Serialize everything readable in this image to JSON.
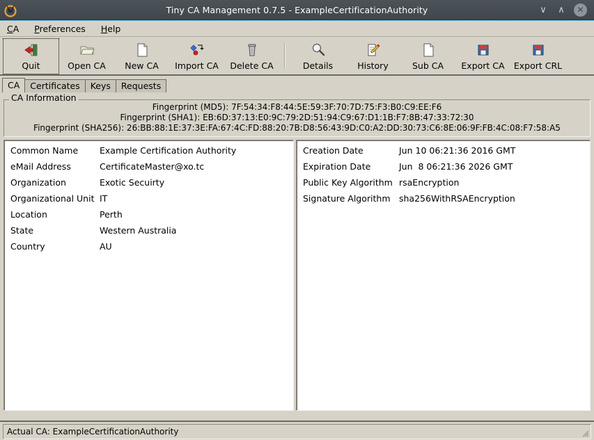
{
  "window": {
    "title": "Tiny CA Management 0.7.5 - ExampleCertificationAuthority",
    "app_icon": "tinyca-logo-icon",
    "minimize_label": "∨",
    "maximize_label": "∧",
    "close_label": "✕"
  },
  "menubar": {
    "items": [
      {
        "label": "CA",
        "mnemonic": "C",
        "rest": "A"
      },
      {
        "label": "Preferences",
        "mnemonic": "P",
        "rest": "references"
      },
      {
        "label": "Help",
        "mnemonic": "H",
        "rest": "elp"
      }
    ]
  },
  "toolbar": {
    "buttons": [
      {
        "label": "Quit",
        "icon": "exit-door-icon",
        "focused": true
      },
      {
        "label": "Open CA",
        "icon": "open-folder-icon",
        "focused": false
      },
      {
        "label": "New CA",
        "icon": "blank-page-icon",
        "focused": false
      },
      {
        "label": "Import CA",
        "icon": "import-arrow-icon",
        "focused": false
      },
      {
        "label": "Delete CA",
        "icon": "trash-can-icon",
        "focused": false
      },
      {
        "label": "Details",
        "icon": "magnifier-icon",
        "focused": false
      },
      {
        "label": "History",
        "icon": "page-pencil-icon",
        "focused": false
      },
      {
        "label": "Sub CA",
        "icon": "blank-page-icon",
        "focused": false
      },
      {
        "label": "Export CA",
        "icon": "floppy-disk-icon",
        "focused": false
      },
      {
        "label": "Export CRL",
        "icon": "floppy-disk-icon",
        "focused": false
      }
    ],
    "separator_after_index": 4
  },
  "tabs": [
    {
      "label": "CA",
      "active": true
    },
    {
      "label": "Certificates",
      "active": false
    },
    {
      "label": "Keys",
      "active": false
    },
    {
      "label": "Requests",
      "active": false
    }
  ],
  "ca_information": {
    "legend": "CA Information",
    "fingerprints": [
      "Fingerprint (MD5): 7F:54:34:F8:44:5E:59:3F:70:7D:75:F3:B0:C9:EE:F6",
      "Fingerprint (SHA1): EB:6D:37:13:E0:9C:79:2D:51:94:C9:67:D1:1B:F7:8B:47:33:72:30",
      "Fingerprint (SHA256): 26:BB:88:1E:37:3E:FA:67:4C:FD:88:20:7B:D8:56:43:9D:C0:A2:DD:30:73:C6:8E:06:9F:FB:4C:08:F7:58:A5"
    ],
    "subject_rows": [
      {
        "key": "Common Name",
        "value": "Example Certification Authority"
      },
      {
        "key": "eMail Address",
        "value": "CertificateMaster@xo.tc"
      },
      {
        "key": "Organization",
        "value": "Exotic Secuirty"
      },
      {
        "key": "Organizational Unit",
        "value": "IT"
      },
      {
        "key": "Location",
        "value": "Perth"
      },
      {
        "key": "State",
        "value": "Western Australia"
      },
      {
        "key": "Country",
        "value": "AU"
      }
    ],
    "detail_rows": [
      {
        "key": "Creation Date",
        "value": "Jun 10 06:21:36 2016 GMT"
      },
      {
        "key": "Expiration Date",
        "value": "Jun  8 06:21:36 2026 GMT"
      },
      {
        "key": "Public Key Algorithm",
        "value": "rsaEncryption"
      },
      {
        "key": "Signature Algorithm",
        "value": "sha256WithRSAEncryption"
      }
    ]
  },
  "statusbar": {
    "text": "Actual CA: ExampleCertificationAuthority",
    "grip": "resize-grip-icon"
  },
  "colors": {
    "window_bg": "#d6d2c8",
    "titlebar_bg": "#434a50",
    "pane_bg": "#ffffff",
    "accent": "#5fb0d8"
  }
}
